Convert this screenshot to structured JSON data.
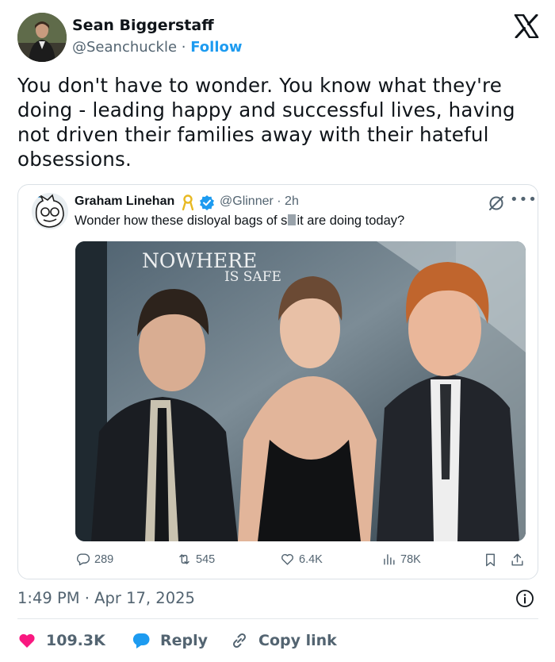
{
  "author": {
    "name": "Sean Biggerstaff",
    "handle": "@Seanchuckle",
    "separator": " · ",
    "follow_label": "Follow"
  },
  "tweet": {
    "text": "You don't have to wonder. You know what they're doing - leading happy and successful lives, having not driven their families away with their hateful obsessions."
  },
  "quoted": {
    "name": "Graham Linehan",
    "handle_time": "@Glinner · 2h",
    "text_before": "Wonder how these disloyal bags of s",
    "text_after": "it are doing today?",
    "poster_line1": "NOWHERE",
    "poster_line2": "IS SAFE",
    "stats": {
      "replies": "289",
      "reposts": "545",
      "likes": "6.4K",
      "views": "78K"
    }
  },
  "timestamp": "1:49 PM · Apr 17, 2025",
  "footer": {
    "likes": "109.3K",
    "reply_label": "Reply",
    "copy_label": "Copy link"
  },
  "colors": {
    "accent": "#1d9bf0",
    "like": "#f91880",
    "text": "#0f1419",
    "muted": "#536471"
  }
}
